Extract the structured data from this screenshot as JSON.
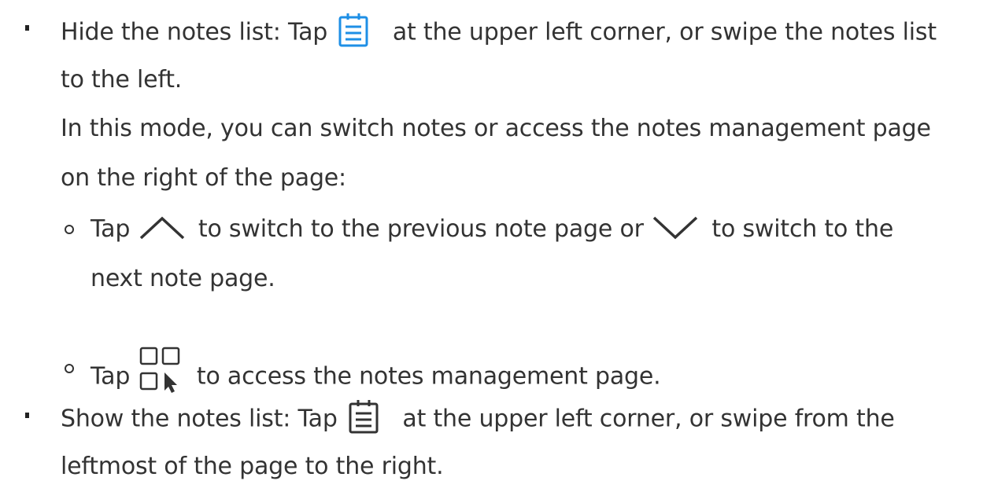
{
  "item_hide": {
    "before_icon": "Hide the notes list: Tap ",
    "icon": "notes-list-icon",
    "icon_color": "#1E8FE6",
    "after_icon": " at the upper left corner, or swipe the notes list",
    "line2": "to the left.",
    "para_line1": "In this mode, you can switch notes or access the notes management page",
    "para_line2": "on the right of the page:",
    "sub_prev": {
      "before_up": "Tap ",
      "up_icon": "chevron-up-icon",
      "middle": " to switch to the previous note page or ",
      "down_icon": "chevron-down-icon",
      "after_down": " to switch to the",
      "line2": "next note page."
    },
    "sub_manage": {
      "before_icon": "Tap ",
      "icon": "notes-management-grid-icon",
      "after_icon": " to access the notes management page."
    }
  },
  "item_show": {
    "before_icon": "Show the notes list: Tap ",
    "icon": "notes-list-icon",
    "icon_color": "#333333",
    "after_icon": " at the upper left corner, or swipe from the",
    "line2": "leftmost of the page to the right."
  }
}
